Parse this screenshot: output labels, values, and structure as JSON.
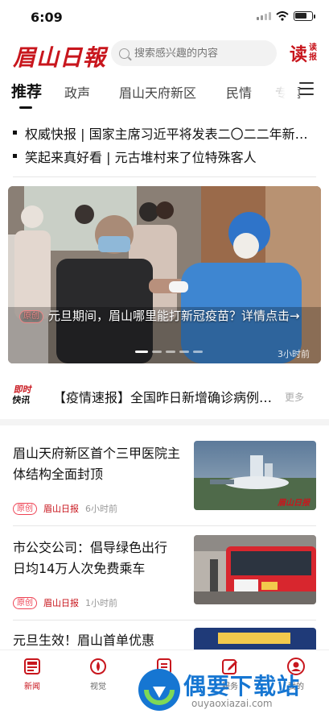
{
  "status_bar": {
    "time": "6:09"
  },
  "header": {
    "logo": "眉山日報",
    "search_placeholder": "搜索感兴趣的内容",
    "read_paper_big": "读",
    "read_paper_small_1": "读",
    "read_paper_small_2": "报"
  },
  "tabs": [
    {
      "label": "推荐",
      "active": true
    },
    {
      "label": "政声"
    },
    {
      "label": "眉山天府新区"
    },
    {
      "label": "民情"
    },
    {
      "label": "专题"
    }
  ],
  "headlines": [
    "权威快报 | 国家主席习近平将发表二〇二二年新年贺词",
    "笑起来真好看 | 元古堆村来了位特殊客人"
  ],
  "banner": {
    "badge": "原创",
    "caption": "元旦期间，眉山哪里能打新冠疫苗？详情点击→",
    "time": "3小时前",
    "slide_count": 5,
    "active_slide": 0
  },
  "flash": {
    "logo_line1": "即时",
    "logo_line2": "快讯",
    "text": "【疫情速报】全国昨日新增确诊病例通报",
    "more": "更多"
  },
  "articles": [
    {
      "title": "眉山天府新区首个三甲医院主体结构全面封顶",
      "badge": "原创",
      "source": "眉山日报",
      "time": "6小时前",
      "thumb_watermark": "眉山日报"
    },
    {
      "title": "市公交公司：倡导绿色出行 日均14万人次免费乘车",
      "badge": "原创",
      "source": "眉山日报",
      "time": "1小时前"
    },
    {
      "title": "元旦生效！眉山首单优惠"
    }
  ],
  "tabbar": [
    {
      "label": "新闻",
      "icon": "newspaper-icon",
      "active": true
    },
    {
      "label": "视觉",
      "icon": "eye-icon"
    },
    {
      "label": "问政",
      "icon": "clipboard-icon"
    },
    {
      "label": "服务",
      "icon": "edit-icon"
    },
    {
      "label": "我的",
      "icon": "user-icon"
    }
  ],
  "watermark": {
    "text": "偶要下载站",
    "url": "ouyaoxiazai.com"
  },
  "colors": {
    "brand_red": "#c8161d",
    "watermark_blue": "#1676d2"
  }
}
